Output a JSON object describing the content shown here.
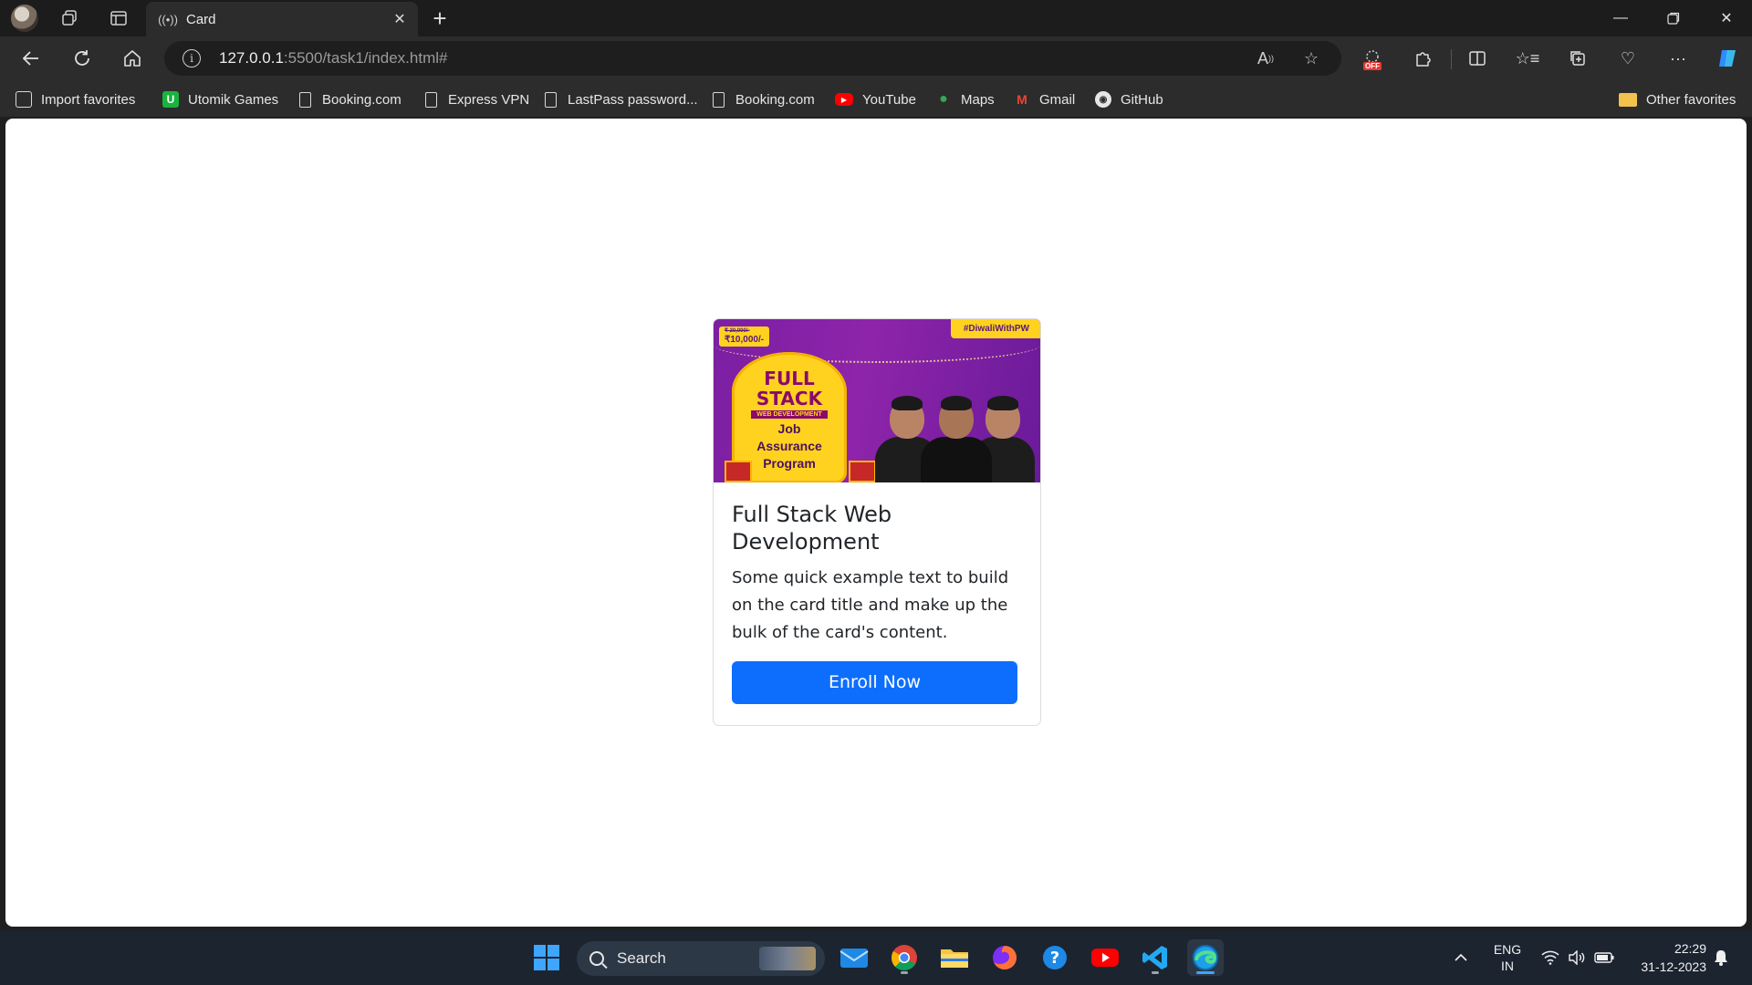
{
  "browser": {
    "tab_title": "Card",
    "url_host": "127.0.0.1",
    "url_path": ":5500/task1/index.html#",
    "favorites": [
      {
        "label": "Import favorites",
        "icon": "import-icon"
      },
      {
        "label": "Utomik Games",
        "icon": "utomik-icon"
      },
      {
        "label": "Booking.com",
        "icon": "page-icon"
      },
      {
        "label": "Express VPN",
        "icon": "page-icon"
      },
      {
        "label": "LastPass password...",
        "icon": "page-icon"
      },
      {
        "label": "Booking.com",
        "icon": "page-icon"
      },
      {
        "label": "YouTube",
        "icon": "youtube-icon"
      },
      {
        "label": "Maps",
        "icon": "maps-icon"
      },
      {
        "label": "Gmail",
        "icon": "gmail-icon"
      },
      {
        "label": "GitHub",
        "icon": "github-icon"
      }
    ],
    "other_favorites": "Other favorites",
    "extension_badge": "OFF"
  },
  "card": {
    "image": {
      "hashtag": "#DiwaliWithPW",
      "price_old": "₹ 20,000/-",
      "price_new": "₹10,000/-",
      "line1": "FULL",
      "line2": "STACK",
      "ribbon": "WEB DEVELOPMENT",
      "line3": "Job",
      "line4": "Assurance",
      "line5": "Program"
    },
    "title": "Full Stack Web Development",
    "text": "Some quick example text to build on the card title and make up the bulk of the card's content.",
    "button_label": "Enroll Now"
  },
  "taskbar": {
    "search_label": "Search",
    "language_line1": "ENG",
    "language_line2": "IN",
    "time": "22:29",
    "date": "31-12-2023"
  },
  "colors": {
    "button": "#0d6efd",
    "banner_purple": "#8e24aa",
    "banner_yellow": "#ffd21f"
  }
}
